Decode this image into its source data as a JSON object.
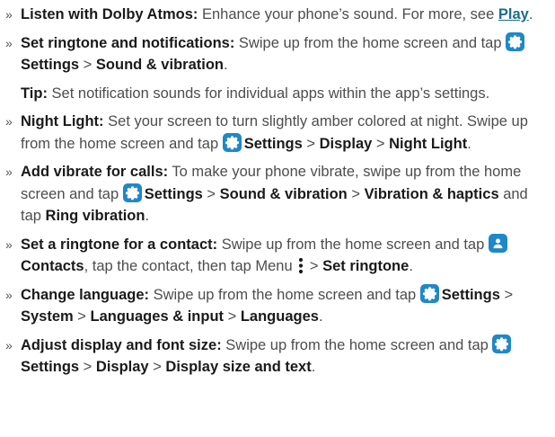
{
  "items": [
    {
      "title": "Listen with Dolby Atmos:",
      "text1": " Enhance your phone’s sound. For more, see ",
      "link": "Play",
      "text2": "."
    },
    {
      "title": "Set ringtone and notifications:",
      "text1": " Swipe up from the home screen and tap ",
      "settings": "Settings",
      "sep": " > ",
      "path1": "Sound & vibration",
      "end": "."
    },
    {
      "tip_label": "Tip:",
      "tip_text": " Set notification sounds for individual apps within the app’s settings."
    },
    {
      "title": "Night Light:",
      "text1": " Set your screen to turn slightly amber colored at night. Swipe up from the home screen and tap ",
      "settings": "Settings",
      "sep": " > ",
      "path1": "Display",
      "sep2": " > ",
      "path2": "Night Light",
      "end": "."
    },
    {
      "title": "Add vibrate for calls:",
      "text1": " To make your phone vibrate, swipe up from the home screen and tap ",
      "settings": "Settings",
      "sep": " > ",
      "path1": "Sound & vibration",
      "sep2": " > ",
      "path2": "Vibration & haptics",
      "text2": " and tap ",
      "path3": "Ring vibration",
      "end": "."
    },
    {
      "title": "Set a ringtone for a contact:",
      "text1": " Swipe up from the home screen and tap ",
      "contacts": "Contacts",
      "text2": ", tap the contact, then tap Menu ",
      "sep": " > ",
      "path1": "Set ringtone",
      "end": "."
    },
    {
      "title": "Change language:",
      "text1": " Swipe up from the home screen and tap ",
      "settings": "Settings",
      "sep": " > ",
      "path1": "System",
      "sep2": " > ",
      "path2": "Languages & input",
      "sep3": " > ",
      "path3": "Languages",
      "end": "."
    },
    {
      "title": "Adjust display and font size:",
      "text1": " Swipe up from the home screen and tap ",
      "settings": "Settings",
      "sep": " > ",
      "path1": "Display",
      "sep2": " > ",
      "path2": "Display size and text",
      "end": "."
    }
  ],
  "bullet": "»",
  "colors": {
    "link": "#1a6e8a",
    "icon_bg": "#1e88c8"
  }
}
